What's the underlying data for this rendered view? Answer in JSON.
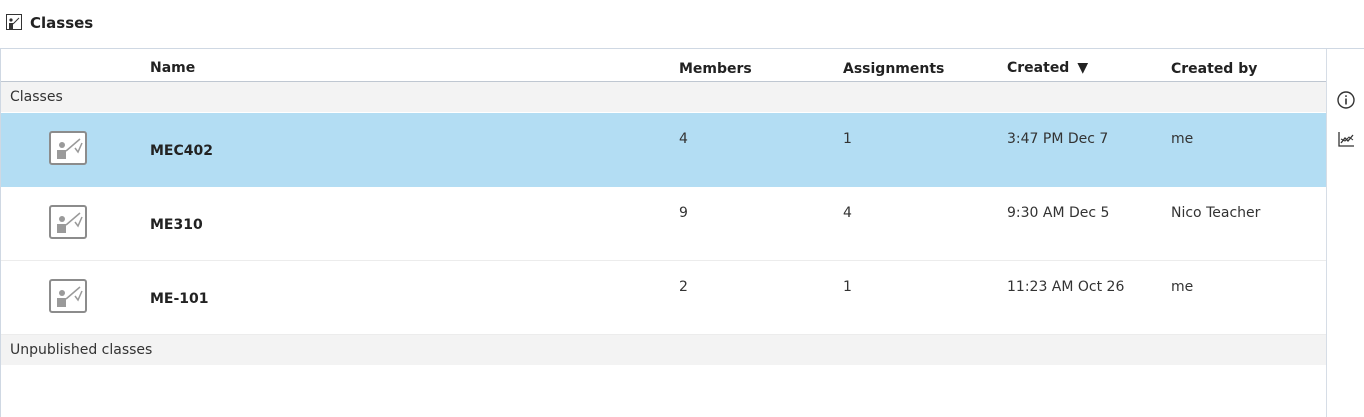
{
  "header": {
    "title": "Classes",
    "icon": "class-icon"
  },
  "columns": {
    "name": "Name",
    "members": "Members",
    "assignments": "Assignments",
    "created": "Created",
    "created_sort_indicator": "▼",
    "created_by": "Created by"
  },
  "sections": {
    "published": "Classes",
    "unpublished": "Unpublished classes"
  },
  "rows": [
    {
      "name": "MEC402",
      "members": "4",
      "assignments": "1",
      "created": "3:47 PM Dec 7",
      "created_by": "me",
      "selected": true
    },
    {
      "name": "ME310",
      "members": "9",
      "assignments": "4",
      "created": "9:30 AM Dec 5",
      "created_by": "Nico Teacher",
      "selected": false
    },
    {
      "name": "ME-101",
      "members": "2",
      "assignments": "1",
      "created": "11:23 AM Oct 26",
      "created_by": "me",
      "selected": false
    }
  ],
  "side_tools": [
    {
      "icon": "info-icon"
    },
    {
      "icon": "chart-icon"
    }
  ],
  "colors": {
    "selected_row": "#b3ddf3",
    "section_bg": "#f3f3f3",
    "divider": "#cfd8e3"
  }
}
